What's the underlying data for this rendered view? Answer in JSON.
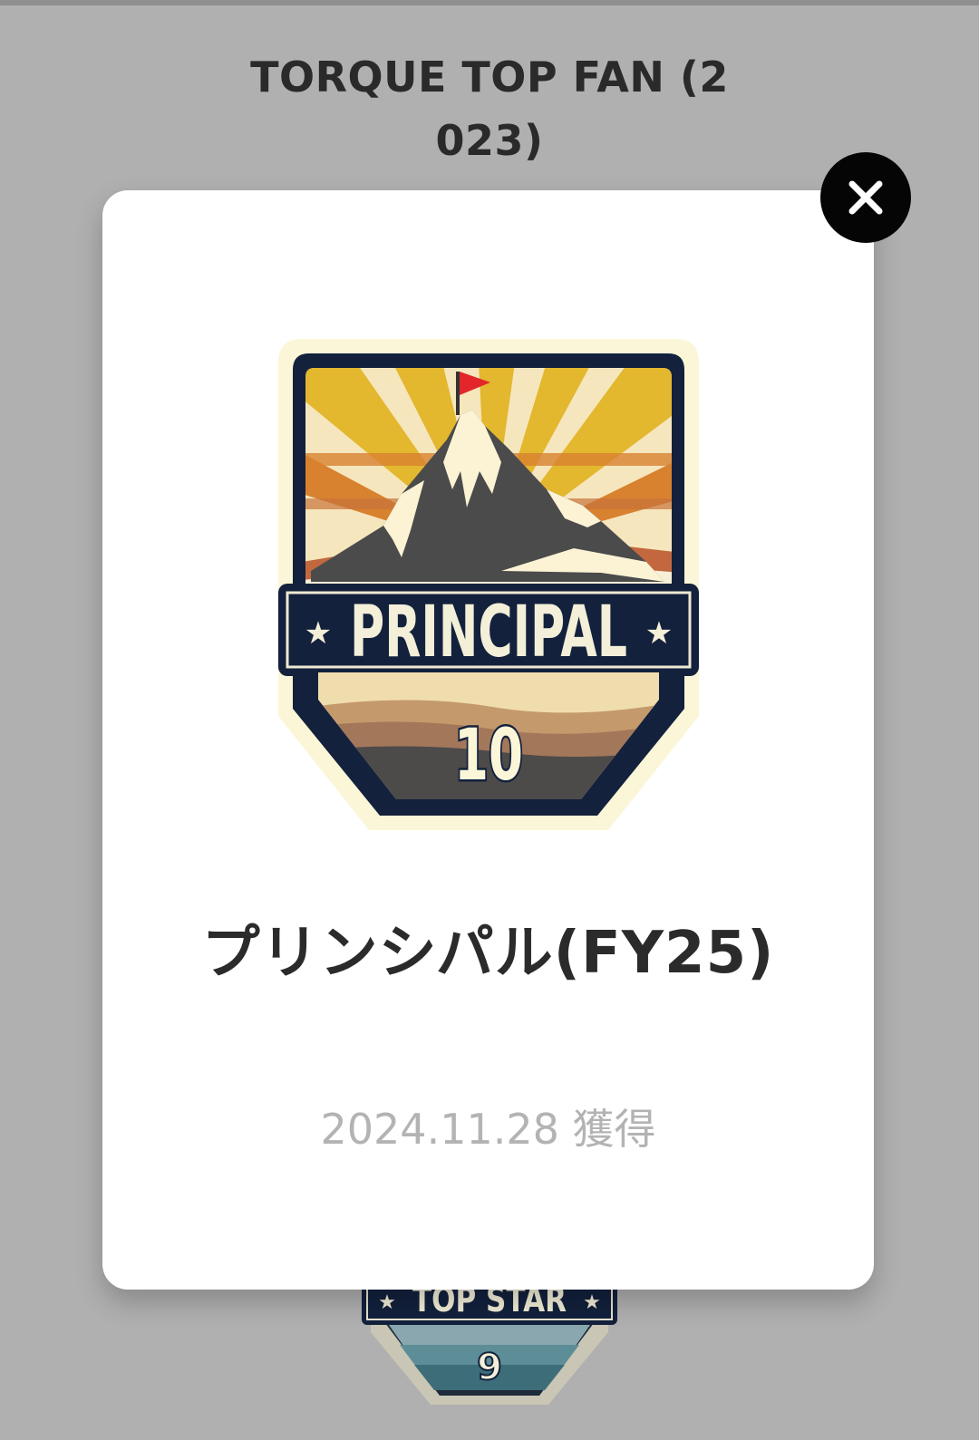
{
  "background": {
    "title": "TORQUE TOP FAN (2023)",
    "badge_behind": {
      "banner_text": "TOP STAR",
      "level": "9"
    }
  },
  "modal": {
    "badge": {
      "banner_text": "PRINCIPAL",
      "level": "10",
      "icon": "mountain-flag-badge-icon"
    },
    "name": "プリンシパル(FY25)",
    "acquired_date": "2024.11.28 獲得"
  },
  "close_button": {
    "icon": "close-icon"
  },
  "colors": {
    "overlay": "#b0b0b0",
    "modal_bg": "#ffffff",
    "close_bg": "#050505",
    "badge_navy": "#13213d",
    "title_text": "#2b2b2b",
    "date_text": "#b3b3b3"
  }
}
